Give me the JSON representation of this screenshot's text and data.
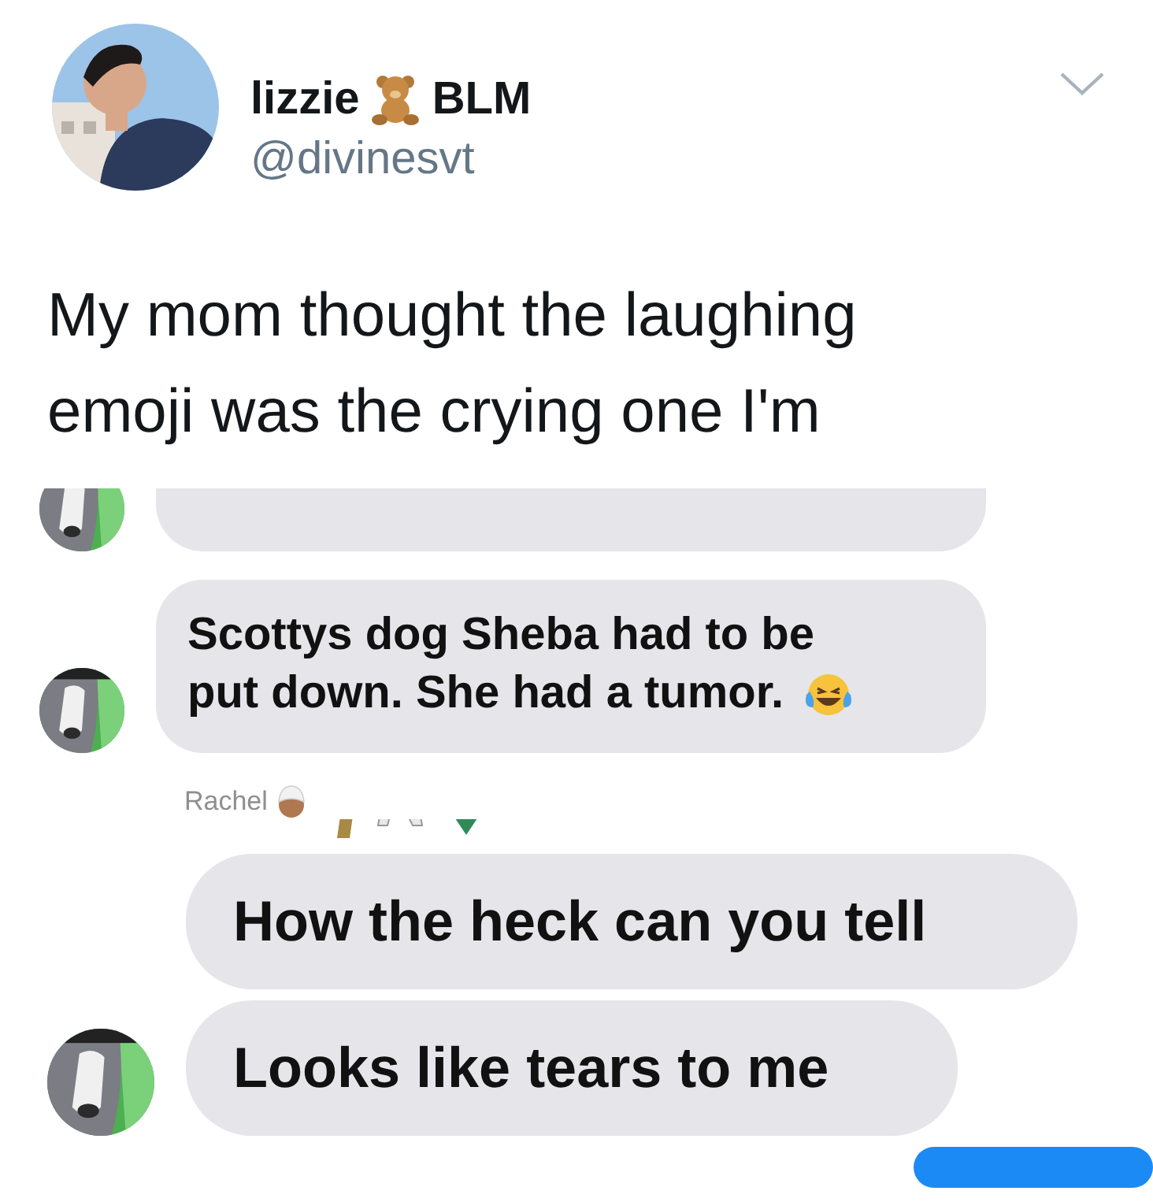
{
  "tweet": {
    "author": {
      "name": "lizzie",
      "suffix": "BLM",
      "handle": "@divinesvt"
    },
    "text_lines": [
      "My mom thought the laughing",
      "emoji was the crying one I'm"
    ]
  },
  "screenshot_crops": [
    {
      "items": [
        {
          "kind": "cut_bubble",
          "avatar": true
        },
        {
          "kind": "bubble",
          "avatar": true,
          "lines": [
            "Scottys dog Sheba had to be",
            "put down. She had a tumor."
          ],
          "emoji": true
        },
        {
          "kind": "sender",
          "name": "Rachel"
        },
        {
          "kind": "cut_emoji_row"
        }
      ]
    },
    {
      "items": [
        {
          "kind": "bubble",
          "avatar": false,
          "lines": [
            "How the heck can you tell"
          ],
          "emoji": false
        },
        {
          "kind": "bubble",
          "avatar": true,
          "lines": [
            "Looks like tears to me"
          ],
          "emoji": false
        },
        {
          "kind": "cut_outgoing"
        }
      ]
    }
  ]
}
